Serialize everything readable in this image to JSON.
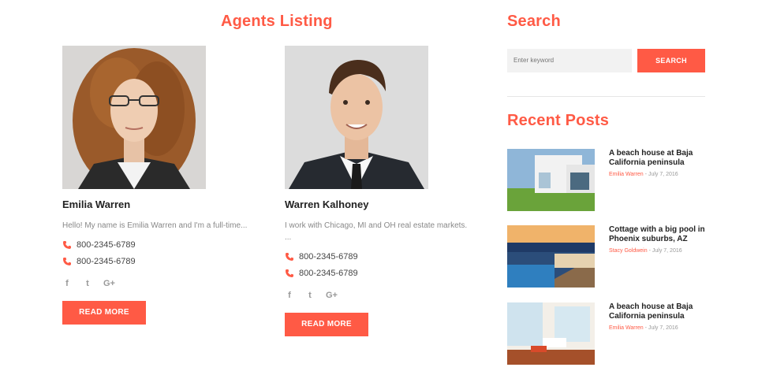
{
  "agents_section": {
    "title": "Agents Listing",
    "agents": [
      {
        "name": "Emilia Warren",
        "bio": "Hello! My name is Emilia Warren and I'm a full-time...",
        "bio_extra": "",
        "phones": [
          "800-2345-6789",
          "800-2345-6789"
        ],
        "socials": [
          "f",
          "t",
          "G+"
        ],
        "button": "READ MORE"
      },
      {
        "name": "Warren Kalhoney",
        "bio": "I work with Chicago, MI and OH real estate markets.",
        "bio_extra": "...",
        "phones": [
          "800-2345-6789",
          "800-2345-6789"
        ],
        "socials": [
          "f",
          "t",
          "G+"
        ],
        "button": "READ MORE"
      }
    ]
  },
  "search": {
    "title": "Search",
    "placeholder": "Enter keyword",
    "button": "SEARCH"
  },
  "recent_posts": {
    "title": "Recent Posts",
    "posts": [
      {
        "title": "A beach house at Baja California peninsula",
        "author": "Emilia Warren",
        "date": "July 7, 2016"
      },
      {
        "title": "Cottage with a big pool in Phoenix suburbs, AZ",
        "author": "Stacy Goldwein",
        "date": "July 7, 2016"
      },
      {
        "title": "A beach house at Baja California peninsula",
        "author": "Emilia Warren",
        "date": "July 7, 2016"
      }
    ]
  },
  "colors": {
    "accent": "#ff5a45",
    "text": "#222222",
    "muted": "#888888",
    "input_bg": "#f2f2f2"
  },
  "icons": {
    "phone": "phone-icon",
    "facebook": "facebook-icon",
    "twitter": "twitter-icon",
    "google_plus": "google-plus-icon"
  }
}
